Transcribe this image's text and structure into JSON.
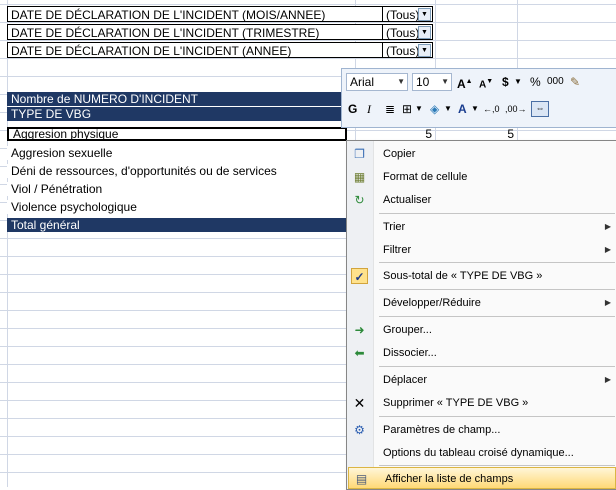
{
  "filters": [
    {
      "label": "DATE DE DÉCLARATION DE L'INCIDENT (MOIS/ANNEE)",
      "value": "(Tous)"
    },
    {
      "label": "DATE DE DÉCLARATION DE L'INCIDENT (TRIMESTRE)",
      "value": "(Tous)"
    },
    {
      "label": "DATE DE DÉCLARATION DE L'INCIDENT (ANNEE)",
      "value": "(Tous)"
    }
  ],
  "pivot": {
    "header1": "Nombre de NUMERO D'INCIDENT",
    "header2": "TYPE DE VBG",
    "rows": [
      {
        "label": "Aggresion physique",
        "v1": "5",
        "v2": "5"
      },
      {
        "label": "Aggresion sexuelle"
      },
      {
        "label": "Déni de ressources, d'opportunités ou de services"
      },
      {
        "label": "Viol / Pénétration"
      },
      {
        "label": "Violence psychologique"
      }
    ],
    "total": "Total général"
  },
  "mini_toolbar": {
    "font": "Arial",
    "size": "10",
    "grow": "A",
    "shrink": "A",
    "currency": "$",
    "percent": "%",
    "thousands": "000",
    "bold": "G",
    "italic": "I"
  },
  "menu": {
    "items": [
      {
        "label": "Copier",
        "icon": "copy-icon"
      },
      {
        "label": "Format de cellule",
        "icon": "format-cells-icon"
      },
      {
        "label": "Actualiser",
        "icon": "refresh-icon"
      },
      {
        "label": "Trier"
      },
      {
        "label": "Filtrer"
      },
      {
        "label": "Sous-total de « TYPE DE VBG »",
        "icon": "checkmark-icon"
      },
      {
        "label": "Développer/Réduire"
      },
      {
        "label": "Grouper...",
        "icon": "group-arrow-icon"
      },
      {
        "label": "Dissocier...",
        "icon": "ungroup-arrow-icon"
      },
      {
        "label": "Déplacer"
      },
      {
        "label": "Supprimer « TYPE DE VBG »",
        "icon": "delete-x-icon"
      },
      {
        "label": "Paramètres de champ...",
        "icon": "field-settings-icon"
      },
      {
        "label": "Options du tableau croisé dynamique..."
      },
      {
        "label": "Afficher la liste de champs",
        "icon": "field-list-icon"
      }
    ]
  }
}
